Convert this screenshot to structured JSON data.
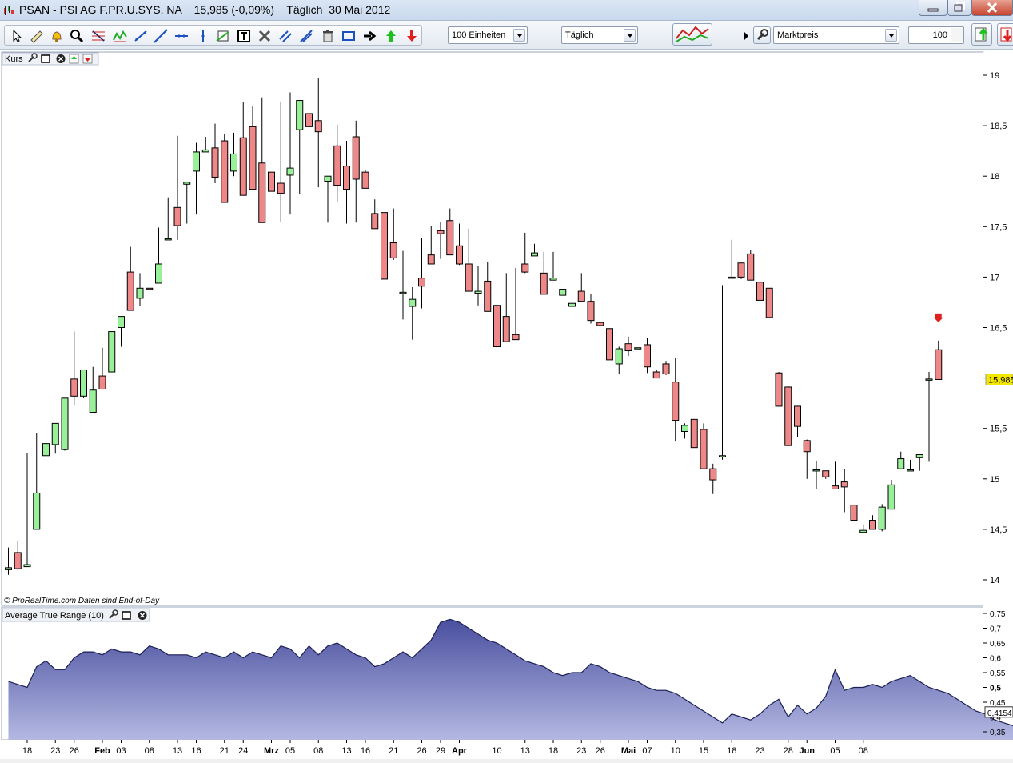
{
  "window": {
    "title": "PSAN - PSI AG F.PR.U.SYS. NA    15,985 (-0,09%)    Täglich  30 Mai 2012"
  },
  "toolbar": {
    "units_select": "100 Einheiten",
    "period_select": "Täglich",
    "price_select": "Marktpreis",
    "quantity_value": "100"
  },
  "icons": [
    "cursor-icon",
    "ruler-icon",
    "alarm-bell-icon",
    "zoom-icon",
    "fibonacci-icon",
    "pattern-icon",
    "trendline-icon",
    "line-icon",
    "horizontal-line-icon",
    "vertical-line-icon",
    "channel-icon",
    "text-icon",
    "hammer-icon",
    "parallel-icon",
    "fan-icon",
    "trash-icon",
    "rectangle-icon",
    "arrow-right-icon",
    "arrow-up-icon",
    "arrow-down-icon",
    "indicator-icon",
    "wrench-icon",
    "buy-icon",
    "sell-icon"
  ],
  "colors": {
    "up": "#98f098",
    "down": "#ee8888",
    "atr_fill_top": "#4a4f9f",
    "atr_fill_bottom": "#b3b8e2",
    "last_price_bg": "#f5e800",
    "signal_arrow": "#e02020"
  },
  "price_panel": {
    "label": "Kurs",
    "footer": "© ProRealTime.com  Daten sind End-of-Day",
    "last_price_label": "15,985",
    "y_ticks": [
      "19",
      "18,5",
      "18",
      "17,5",
      "17",
      "16,5",
      "16",
      "15,5",
      "15",
      "14,5",
      "14"
    ]
  },
  "atr_panel": {
    "label": "Average True Range (10)",
    "last_value_label": "0,4154",
    "y_ticks": [
      "0,75",
      "0,7",
      "0,65",
      "0,6",
      "0,55",
      "0,5",
      "0,45",
      "0,4",
      "0,35"
    ]
  },
  "x_axis": {
    "labels": [
      "18",
      "23",
      "26",
      "Feb",
      "03",
      "08",
      "13",
      "16",
      "21",
      "24",
      "Mrz",
      "05",
      "08",
      "13",
      "16",
      "21",
      "26",
      "29",
      "Apr",
      "10",
      "13",
      "18",
      "23",
      "26",
      "Mai",
      "07",
      "10",
      "15",
      "18",
      "23",
      "28",
      "Jun",
      "05",
      "08"
    ]
  },
  "chart_data": [
    {
      "type": "candlestick",
      "title": "Kurs",
      "series_name": "PSAN",
      "ylim": [
        13.85,
        19.2
      ],
      "candles": [
        [
          14.1,
          14.32,
          14.05,
          14.12
        ],
        [
          14.27,
          14.38,
          14.1,
          14.11
        ],
        [
          14.13,
          15.26,
          14.13,
          14.15
        ],
        [
          14.5,
          15.45,
          14.5,
          14.86
        ],
        [
          15.23,
          15.32,
          15.14,
          15.35
        ],
        [
          15.34,
          15.38,
          15.25,
          15.55
        ],
        [
          15.29,
          15.62,
          15.28,
          15.8
        ],
        [
          15.99,
          16.46,
          15.73,
          15.82
        ],
        [
          15.82,
          15.84,
          15.8,
          16.08
        ],
        [
          15.66,
          16.11,
          15.7,
          15.88
        ],
        [
          16.02,
          16.3,
          15.97,
          15.89
        ],
        [
          16.06,
          16.2,
          16.14,
          16.46
        ],
        [
          16.5,
          16.5,
          16.31,
          16.61
        ],
        [
          17.05,
          17.3,
          16.77,
          16.67
        ],
        [
          16.79,
          17.04,
          16.71,
          16.89
        ],
        [
          16.89,
          16.86,
          16.95,
          16.88
        ],
        [
          16.94,
          17.49,
          17.1,
          17.13
        ],
        [
          17.38,
          17.79,
          17.49,
          17.38
        ],
        [
          17.69,
          18.4,
          17.37,
          17.51
        ],
        [
          17.92,
          17.61,
          17.53,
          17.94
        ],
        [
          18.05,
          18.33,
          17.62,
          18.24
        ],
        [
          18.24,
          18.39,
          18.36,
          18.26
        ],
        [
          18.28,
          18.52,
          17.93,
          17.99
        ],
        [
          18.35,
          18.42,
          18.09,
          17.74
        ],
        [
          18.05,
          18.43,
          18.0,
          18.22
        ],
        [
          18.38,
          18.73,
          18.01,
          17.81
        ],
        [
          18.49,
          18.69,
          18.04,
          17.87
        ],
        [
          18.13,
          18.78,
          17.55,
          17.54
        ],
        [
          18.04,
          17.86,
          17.91,
          17.85
        ],
        [
          17.93,
          18.74,
          17.55,
          17.83
        ],
        [
          18.01,
          18.83,
          17.62,
          18.08
        ],
        [
          18.46,
          18.68,
          17.82,
          18.75
        ],
        [
          18.62,
          18.86,
          17.93,
          18.49
        ],
        [
          18.55,
          18.97,
          17.89,
          18.44
        ],
        [
          17.95,
          17.94,
          17.54,
          18.0
        ],
        [
          18.3,
          18.51,
          17.74,
          17.91
        ],
        [
          18.1,
          18.35,
          17.53,
          17.87
        ],
        [
          18.39,
          18.55,
          17.54,
          17.97
        ],
        [
          18.04,
          18.06,
          17.94,
          17.88
        ],
        [
          17.63,
          17.77,
          17.51,
          17.48
        ],
        [
          17.64,
          17.62,
          17.51,
          16.98
        ],
        [
          17.34,
          17.68,
          17.17,
          17.19
        ],
        [
          16.85,
          17.26,
          16.58,
          16.85
        ],
        [
          16.71,
          16.9,
          16.38,
          16.78
        ],
        [
          16.99,
          17.39,
          16.69,
          16.91
        ],
        [
          17.22,
          17.51,
          17.18,
          17.13
        ],
        [
          17.46,
          17.55,
          17.18,
          17.43
        ],
        [
          17.56,
          17.68,
          17.22,
          17.22
        ],
        [
          17.31,
          17.53,
          17.12,
          17.13
        ],
        [
          17.13,
          17.48,
          17.06,
          16.86
        ],
        [
          16.84,
          17.11,
          16.72,
          16.86
        ],
        [
          16.96,
          17.15,
          16.8,
          16.66
        ],
        [
          16.72,
          17.09,
          16.47,
          16.31
        ],
        [
          16.61,
          17.04,
          16.47,
          16.36
        ],
        [
          16.43,
          17.09,
          16.43,
          16.38
        ],
        [
          17.13,
          17.44,
          17.04,
          17.05
        ],
        [
          17.21,
          17.33,
          17.23,
          17.24
        ],
        [
          17.04,
          17.25,
          16.85,
          16.83
        ],
        [
          16.97,
          17.25,
          17.01,
          16.99
        ],
        [
          16.82,
          16.88,
          16.88,
          16.88
        ],
        [
          16.71,
          16.91,
          16.67,
          16.74
        ],
        [
          16.86,
          17.04,
          16.77,
          16.76
        ],
        [
          16.76,
          16.83,
          16.54,
          16.57
        ],
        [
          16.55,
          16.53,
          16.51,
          16.52
        ],
        [
          16.49,
          16.46,
          16.22,
          16.18
        ],
        [
          16.14,
          16.31,
          16.04,
          16.29
        ],
        [
          16.34,
          16.41,
          16.22,
          16.27
        ],
        [
          16.29,
          16.28,
          16.31,
          16.3
        ],
        [
          16.33,
          16.4,
          16.05,
          16.11
        ],
        [
          16.06,
          16.08,
          16.04,
          16.0
        ],
        [
          16.14,
          16.17,
          16.03,
          16.04
        ],
        [
          15.96,
          16.2,
          15.37,
          15.58
        ],
        [
          15.47,
          15.55,
          15.4,
          15.53
        ],
        [
          15.59,
          15.56,
          15.42,
          15.31
        ],
        [
          15.49,
          15.55,
          15.15,
          15.1
        ],
        [
          15.1,
          15.15,
          14.85,
          14.99
        ],
        [
          15.22,
          16.92,
          15.19,
          15.23
        ],
        [
          17.0,
          17.37,
          17.02,
          17.0
        ],
        [
          17.14,
          17.14,
          16.98,
          17.0
        ],
        [
          17.23,
          17.27,
          16.97,
          16.97
        ],
        [
          16.95,
          17.12,
          16.85,
          16.77
        ],
        [
          16.89,
          16.78,
          16.7,
          16.6
        ],
        [
          16.05,
          16.06,
          15.84,
          15.72
        ],
        [
          15.91,
          15.92,
          15.43,
          15.33
        ],
        [
          15.72,
          15.69,
          15.41,
          15.52
        ],
        [
          15.38,
          15.39,
          15.0,
          15.27
        ],
        [
          15.08,
          15.18,
          14.9,
          15.09
        ],
        [
          15.08,
          15.07,
          15.0,
          15.02
        ],
        [
          14.93,
          15.17,
          14.95,
          14.9
        ],
        [
          14.97,
          15.1,
          14.67,
          14.92
        ],
        [
          14.74,
          14.71,
          14.65,
          14.59
        ],
        [
          14.47,
          14.55,
          14.47,
          14.49
        ],
        [
          14.59,
          14.64,
          14.5,
          14.5
        ],
        [
          14.5,
          14.75,
          14.48,
          14.72
        ],
        [
          14.7,
          14.99,
          14.81,
          14.94
        ],
        [
          15.1,
          15.27,
          15.22,
          15.2
        ],
        [
          15.09,
          15.19,
          15.08,
          15.09
        ],
        [
          15.21,
          15.2,
          15.08,
          15.24
        ],
        [
          15.99,
          16.06,
          15.17,
          15.99
        ],
        [
          16.28,
          16.37,
          15.99,
          15.985
        ]
      ],
      "sell_signal_marker": true
    },
    {
      "type": "area",
      "title": "Average True Range (10)",
      "ylim": [
        0.33,
        0.77
      ],
      "values": [
        0.52,
        0.51,
        0.5,
        0.57,
        0.59,
        0.56,
        0.56,
        0.6,
        0.62,
        0.62,
        0.61,
        0.63,
        0.62,
        0.62,
        0.61,
        0.64,
        0.63,
        0.61,
        0.61,
        0.61,
        0.6,
        0.62,
        0.61,
        0.6,
        0.62,
        0.6,
        0.62,
        0.61,
        0.6,
        0.64,
        0.63,
        0.6,
        0.64,
        0.61,
        0.64,
        0.65,
        0.63,
        0.61,
        0.6,
        0.57,
        0.58,
        0.6,
        0.62,
        0.6,
        0.63,
        0.66,
        0.72,
        0.73,
        0.72,
        0.7,
        0.68,
        0.66,
        0.65,
        0.63,
        0.61,
        0.59,
        0.58,
        0.57,
        0.55,
        0.54,
        0.55,
        0.55,
        0.58,
        0.57,
        0.55,
        0.54,
        0.53,
        0.52,
        0.5,
        0.49,
        0.49,
        0.48,
        0.46,
        0.44,
        0.42,
        0.4,
        0.38,
        0.41,
        0.4,
        0.39,
        0.41,
        0.44,
        0.46,
        0.4,
        0.44,
        0.41,
        0.43,
        0.47,
        0.56,
        0.49,
        0.5,
        0.5,
        0.51,
        0.5,
        0.52,
        0.53,
        0.54,
        0.52,
        0.5,
        0.49,
        0.48,
        0.46,
        0.44,
        0.42,
        0.41,
        0.39,
        0.38,
        0.37,
        0.36,
        0.35,
        0.41,
        0.4154
      ]
    }
  ]
}
